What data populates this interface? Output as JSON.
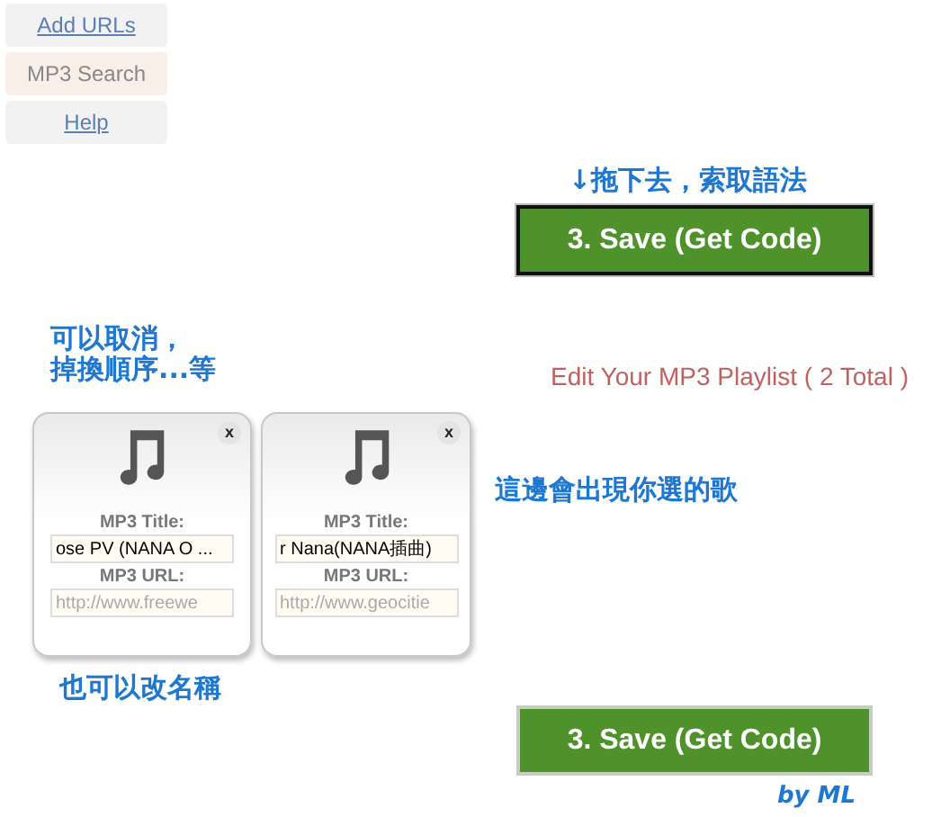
{
  "nav": [
    {
      "label": "Add URLs",
      "selected": false
    },
    {
      "label": "MP3 Search",
      "selected": true
    },
    {
      "label": "Help",
      "selected": false
    }
  ],
  "save_buttons": [
    {
      "label": "3. Save (Get Code)",
      "focused": true
    },
    {
      "label": "3. Save (Get Code)",
      "focused": false
    }
  ],
  "playlist": {
    "title": "Edit Your MP3 Playlist ( 2 Total )",
    "items": [
      {
        "close": "x",
        "title_label": "MP3 Title:",
        "title_value": "ose PV (NANA O ...",
        "url_label": "MP3 URL:",
        "url_value": "http://www.freewe"
      },
      {
        "close": "x",
        "title_label": "MP3 Title:",
        "title_value": "r Nana(NANA插曲)",
        "url_label": "MP3 URL:",
        "url_value": "http://www.geocitie"
      }
    ]
  },
  "annotations": [
    {
      "text": "↓拖下去，索取語法"
    },
    {
      "text": "可以取消，"
    },
    {
      "text": "掉換順序...等"
    },
    {
      "text": "這邊會出現你選的歌"
    },
    {
      "text": "也可以改名稱"
    },
    {
      "text": "by ML"
    }
  ]
}
